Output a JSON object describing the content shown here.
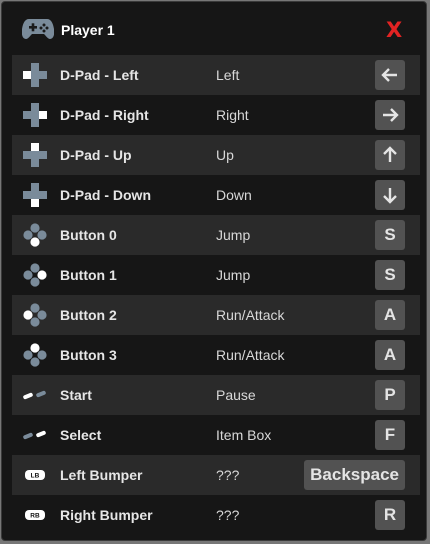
{
  "header": {
    "title": "Player 1",
    "close_label": "X"
  },
  "bindings": [
    {
      "name": "D-Pad - Left",
      "action": "Left",
      "key": "←",
      "icon": "dpad-left-icon"
    },
    {
      "name": "D-Pad - Right",
      "action": "Right",
      "key": "→",
      "icon": "dpad-right-icon"
    },
    {
      "name": "D-Pad - Up",
      "action": "Up",
      "key": "↑",
      "icon": "dpad-up-icon"
    },
    {
      "name": "D-Pad - Down",
      "action": "Down",
      "key": "↓",
      "icon": "dpad-down-icon"
    },
    {
      "name": "Button 0",
      "action": "Jump",
      "key": "S",
      "icon": "face-button-bottom-icon"
    },
    {
      "name": "Button 1",
      "action": "Jump",
      "key": "S",
      "icon": "face-button-right-icon"
    },
    {
      "name": "Button 2",
      "action": "Run/Attack",
      "key": "A",
      "icon": "face-button-left-icon"
    },
    {
      "name": "Button 3",
      "action": "Run/Attack",
      "key": "A",
      "icon": "face-button-top-icon"
    },
    {
      "name": "Start",
      "action": "Pause",
      "key": "P",
      "icon": "start-button-icon"
    },
    {
      "name": "Select",
      "action": "Item Box",
      "key": "F",
      "icon": "select-button-icon"
    },
    {
      "name": "Left Bumper",
      "action": "???",
      "key": "Backspace",
      "icon": "left-bumper-icon",
      "icon_text": "LB"
    },
    {
      "name": "Right Bumper",
      "action": "???",
      "key": "R",
      "icon": "right-bumper-icon",
      "icon_text": "RB"
    }
  ],
  "colors": {
    "close": "#e22323",
    "icon_dim": "#7a8b9a",
    "icon_highlight": "#ffffff"
  }
}
